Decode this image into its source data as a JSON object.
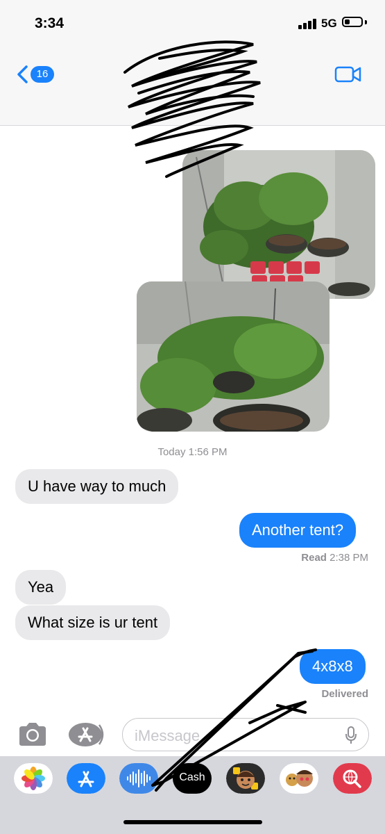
{
  "status_bar": {
    "time": "3:34",
    "network": "5G",
    "battery_level": 0.3
  },
  "header": {
    "back_count": "16"
  },
  "messages": {
    "timestamp": "Today 1:56 PM",
    "items": [
      {
        "direction": "incoming",
        "text": "U have way to much"
      },
      {
        "direction": "outgoing",
        "text": "Another tent?"
      },
      {
        "direction": "incoming",
        "text": "Yea"
      },
      {
        "direction": "incoming",
        "text": "What size is ur tent"
      },
      {
        "direction": "outgoing",
        "text": "4x8x8"
      }
    ],
    "read_label": "Read",
    "read_time": "2:38 PM",
    "delivered": "Delivered"
  },
  "input": {
    "placeholder": "iMessage"
  },
  "drawer": {
    "apps": [
      "photos-icon",
      "app-store-icon",
      "audio-message-icon",
      "apple-cash-icon",
      "memoji-icon",
      "memoji-stickers-icon",
      "web-search-icon"
    ],
    "cash_label": "Cash"
  },
  "colors": {
    "accent": "#1a82fb",
    "incoming_bubble": "#e9e9eb",
    "header_bg": "#f7f7f8",
    "drawer_bg": "#d6d7dd"
  }
}
